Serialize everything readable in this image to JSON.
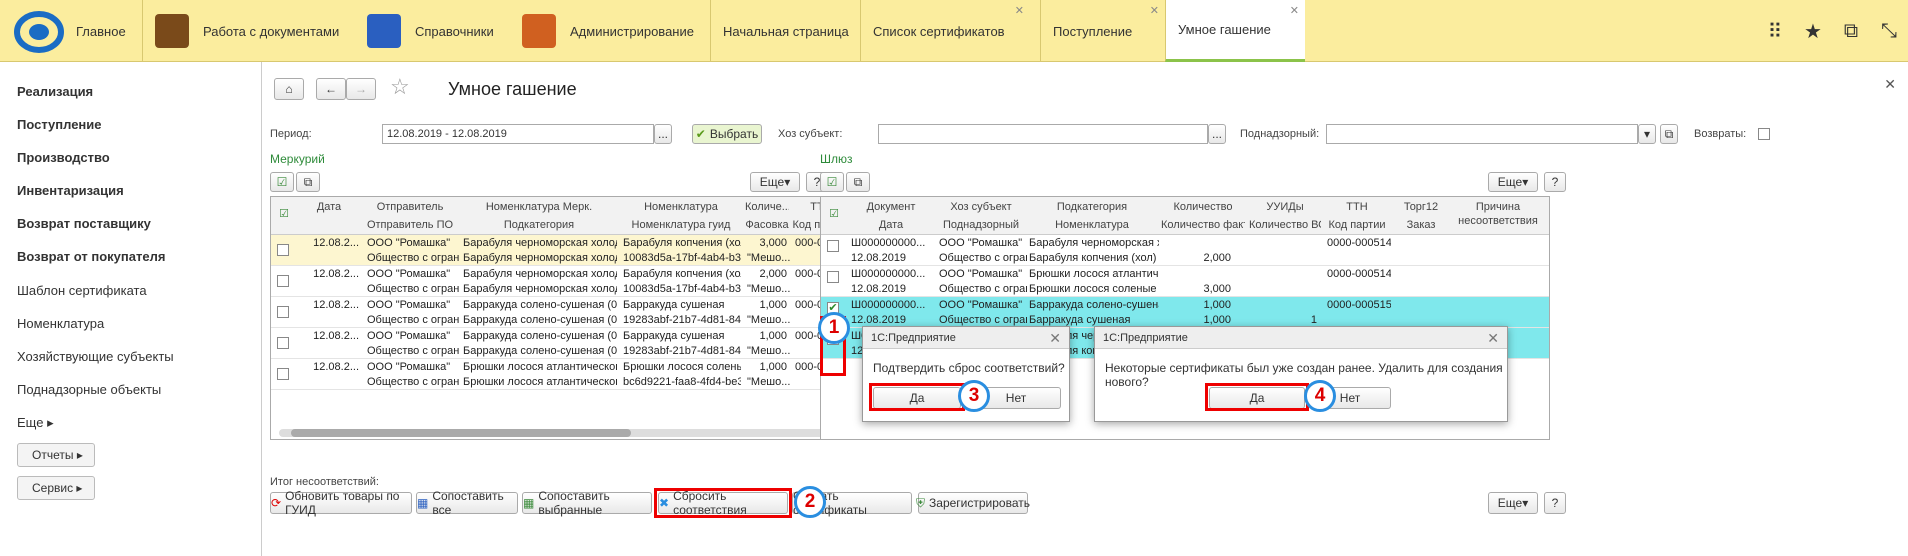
{
  "topbar": {
    "sections": [
      {
        "label": "Главное",
        "color": "#1a6cc4"
      },
      {
        "label": "Работа с документами",
        "color": "#7a4a1a"
      },
      {
        "label": "Справочники",
        "color": "#2a5fc0"
      },
      {
        "label": "Администрирование",
        "color": "#d06020"
      }
    ],
    "tabs": [
      "Начальная страница",
      "Список сертификатов",
      "Поступление",
      "Умное гашение"
    ]
  },
  "sidebar": {
    "bold": [
      "Реализация",
      "Поступление",
      "Производство",
      "Инвентаризация",
      "Возврат поставщику",
      "Возврат от покупателя"
    ],
    "normal": [
      "Шаблон сертификата",
      "Номенклатура",
      "Хозяйствующие субъекты",
      "Поднадзорные объекты"
    ],
    "more": "Еще",
    "reports": "Отчеты",
    "service": "Сервис"
  },
  "page": {
    "title": "Умное гашение"
  },
  "filters": {
    "period_label": "Период:",
    "period_value": "12.08.2019 - 12.08.2019",
    "select_btn": "Выбрать",
    "hoz_label": "Хоз субъект:",
    "pod_label": "Поднадзорный:",
    "return_label": "Возвраты:"
  },
  "mercury": {
    "title": "Меркурий",
    "more": "Еще",
    "help": "?",
    "headers1": [
      "Дата",
      "Отправитель",
      "Номенклатура Мерк.",
      "Номенклатура",
      "Количе...",
      "ТТН"
    ],
    "headers2": [
      "Отправитель ПО",
      "Подкатегория",
      "Номенклатура гуид",
      "Фасовка",
      "Код партии"
    ],
    "rows": [
      {
        "date": "12.08.2...",
        "sender": "ООО \"Ромашка\"",
        "nom_merk": "Барабуля черноморская холодног...",
        "nom": "Барабуля копчения (хол)",
        "qty": "3,000",
        "ttn": "000-000515",
        "sender_po": "Общество с огран...",
        "subcat": "Барабуля черноморская холодног...",
        "guid": "10083d5a-17bf-4ab4-b3dc-...",
        "fas": "\"Мешо...",
        "hl": true
      },
      {
        "date": "12.08.2...",
        "sender": "ООО \"Ромашка\"",
        "nom_merk": "Барабуля черноморская холодног...",
        "nom": "Барабуля копчения (хол)",
        "qty": "2,000",
        "ttn": "000-000514",
        "sender_po": "Общество с огран...",
        "subcat": "Барабуля черноморская холодног...",
        "guid": "10083d5a-17bf-4ab4-b3dc-...",
        "fas": "\"Мешо...",
        "hl": false
      },
      {
        "date": "12.08.2...",
        "sender": "ООО \"Ромашка\"",
        "nom_merk": "Барракуда солено-сушеная (0305)",
        "nom": "Барракуда сушеная",
        "qty": "1,000",
        "ttn": "000-000515",
        "sender_po": "Общество с огран...",
        "subcat": "Барракуда солено-сушеная (0305)",
        "guid": "19283abf-21b7-4d81-84ec-...",
        "fas": "\"Мешо...",
        "hl": false
      },
      {
        "date": "12.08.2...",
        "sender": "ООО \"Ромашка\"",
        "nom_merk": "Барракуда солено-сушеная (0305)",
        "nom": "Барракуда сушеная",
        "qty": "1,000",
        "ttn": "000-000514",
        "sender_po": "Общество с огран...",
        "subcat": "Барракуда солено-сушеная (0305)",
        "guid": "19283abf-21b7-4d81-84ec-...",
        "fas": "\"Мешо...",
        "hl": false
      },
      {
        "date": "12.08.2...",
        "sender": "ООО \"Ромашка\"",
        "nom_merk": "Брюшки лосося атлантического с...",
        "nom": "Брюшки лосося соленые",
        "qty": "1,000",
        "ttn": "000-000515",
        "sender_po": "Общество с огран...",
        "subcat": "Брюшки лосося атлантического с...",
        "guid": "bc6d9221-faa8-4fd4-be3c-f...",
        "fas": "\"Мешо...",
        "hl": false
      }
    ]
  },
  "shluz": {
    "title": "Шлюз",
    "more": "Еще",
    "help": "?",
    "headers1": [
      "Документ",
      "Хоз субъект",
      "Подкатегория",
      "Количество",
      "УУИДы",
      "ТТН",
      "Торг12",
      "Причина"
    ],
    "headers2": [
      "Дата",
      "Поднадзорный",
      "Номенклатура",
      "Количество факт",
      "Количество ВСД",
      "Код партии",
      "Заказ",
      "несоответствия"
    ],
    "rows": [
      {
        "doc": "Ш000000000...",
        "hoz": "ООО \"Ромашка\"",
        "sub": "Барабуля черноморская хол...",
        "qty": "",
        "ttn": "0000-000514",
        "date": "12.08.2019",
        "pod": "Общество с огран...",
        "nom": "Барабуля копчения (хол)",
        "qfact": "2,000",
        "vsd": "",
        "checked": false,
        "hl": false
      },
      {
        "doc": "Ш000000000...",
        "hoz": "ООО \"Ромашка\"",
        "sub": "Брюшки лосося атлантичес...",
        "qty": "",
        "ttn": "0000-000514",
        "date": "12.08.2019",
        "pod": "Общество с огран...",
        "nom": "Брюшки лосося соленые",
        "qfact": "3,000",
        "vsd": "",
        "checked": false,
        "hl": false
      },
      {
        "doc": "Ш000000000...",
        "hoz": "ООО \"Ромашка\"",
        "sub": "Барракуда солено-сушеная (...",
        "qty": "1,000",
        "ttn": "0000-000515",
        "date": "12.08.2019",
        "pod": "Общество с огран...",
        "nom": "Барракуда сушеная",
        "qfact": "1,000",
        "vsd": "1",
        "checked": true,
        "hl": true
      },
      {
        "doc": "Ш000000000...",
        "hoz": "ООО \"Ромашка\"",
        "sub": "Барабуля черноморская хол...",
        "qty": "3,000",
        "ttn": "0000-000515",
        "date": "12.08.2019",
        "pod": "Общество с огран...",
        "nom": "Барабуля копчения (хол)",
        "qfact": "3,000",
        "vsd": "1",
        "checked": true,
        "hl": true
      }
    ]
  },
  "bottom": {
    "itog": "Итог несоответствий:",
    "btns": [
      "Обновить товары по ГУИД",
      "Сопоставить все",
      "Сопоставить выбранные",
      "Сбросить соответствия",
      "Создать сертификаты",
      "Зарегистрировать"
    ],
    "more": "Еще",
    "help": "?"
  },
  "dialog1": {
    "title": "1С:Предприятие",
    "text": "Подтвердить сброс соответствий?",
    "yes": "Да",
    "no": "Нет"
  },
  "dialog2": {
    "title": "1С:Предприятие",
    "text": "Некоторые сертификаты был уже создан ранее. Удалить для создания нового?",
    "yes": "Да",
    "no": "Нет"
  },
  "markers": [
    "1",
    "2",
    "3",
    "4"
  ]
}
